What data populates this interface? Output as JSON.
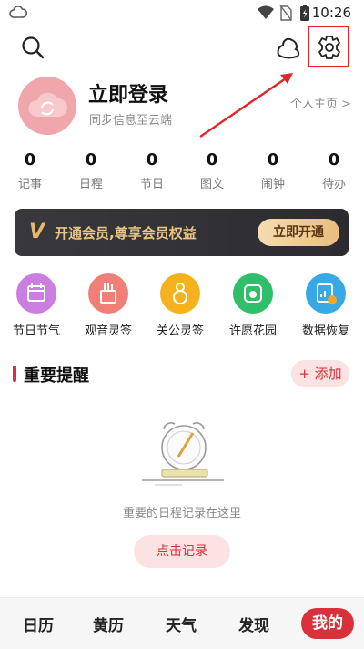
{
  "status_bar": {
    "time": "10:26",
    "icons": [
      "cloud-icon",
      "wifi-icon",
      "no-sim-icon",
      "battery-icon"
    ]
  },
  "header": {
    "icons": [
      "search-icon",
      "skin-icon",
      "settings-icon"
    ]
  },
  "profile": {
    "title": "立即登录",
    "subtitle": "同步信息至云端",
    "homepage_link": "个人主页 >"
  },
  "stats": [
    {
      "value": "0",
      "label": "记事"
    },
    {
      "value": "0",
      "label": "日程"
    },
    {
      "value": "0",
      "label": "节日"
    },
    {
      "value": "0",
      "label": "图文"
    },
    {
      "value": "0",
      "label": "闹钟"
    },
    {
      "value": "0",
      "label": "待办"
    }
  ],
  "vip": {
    "badge": "V",
    "text": "开通会员,尊享会员权益",
    "button": "立即开通"
  },
  "features": [
    {
      "label": "节日节气",
      "color": "#c97ee0"
    },
    {
      "label": "观音灵签",
      "color": "#f07f78"
    },
    {
      "label": "关公灵签",
      "color": "#f5b21e"
    },
    {
      "label": "许愿花园",
      "color": "#2fbf6b"
    },
    {
      "label": "数据恢复",
      "color": "#37a9e4"
    }
  ],
  "reminders": {
    "title": "重要提醒",
    "add_button": "+ 添加",
    "empty_text": "重要的日程记录在这里",
    "record_button": "点击记录"
  },
  "bottom_nav": {
    "items": [
      "日历",
      "黄历",
      "天气",
      "发现"
    ],
    "active": "我的"
  },
  "colors": {
    "accent": "#d9313a",
    "annotation": "#e0262c"
  }
}
